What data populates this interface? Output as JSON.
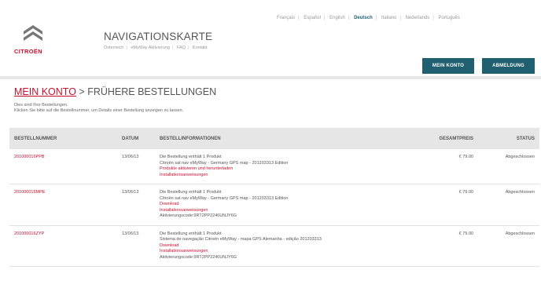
{
  "header": {
    "languages": [
      "Français",
      "Español",
      "English",
      "Deutsch",
      "Italiano",
      "Nederlands",
      "Português"
    ],
    "active_language": "Deutsch",
    "logo_text": "CITROËN",
    "site_title": "NAVIGATIONSKARTE",
    "subnav": [
      "Österreich",
      "eMyWay Aktivierung",
      "FAQ",
      "Kontakt"
    ],
    "buttons": {
      "account": "MEIN KONTO",
      "logout": "ABMELDUNG"
    }
  },
  "page": {
    "breadcrumb_link": "MEIN KONTO",
    "breadcrumb_separator": " > ",
    "breadcrumb_current": "FRÜHERE BESTELLUNGEN",
    "intro_line1": "Dies sind Ihre Bestellungen.",
    "intro_line2": "Klicken Sie bitte auf die Bestellnummer, um Details einer Bestellung anzeigen zu lassen."
  },
  "table": {
    "headers": {
      "order": "BESTELLNUMMER",
      "date": "DATUM",
      "info": "BESTELLINFORMATIONEN",
      "price": "GESAMTPREIS",
      "status": "STATUS"
    },
    "rows": [
      {
        "order": "201000016PPB",
        "date": "13/06/13",
        "info": [
          {
            "text": "Die Bestellung enthält 1 Produkt",
            "red": false
          },
          {
            "text": "Citroën sat nav eMyWay - Germany GPS map - 201203313 Edition",
            "red": false
          },
          {
            "text": "Produkte aktivieren und herunterladen",
            "red": true
          },
          {
            "text": "Installationsanweisungen",
            "red": true
          }
        ],
        "price": "€ 79.00",
        "status": "Abgeschlossen"
      },
      {
        "order": "201000016MPE",
        "date": "13/06/13",
        "info": [
          {
            "text": "Die Bestellung enthält 1 Produkt",
            "red": false
          },
          {
            "text": "Citroën sat nav eMyWay - Germany GPS map - 201203313 Edition",
            "red": false
          },
          {
            "text": "Download",
            "red": true
          },
          {
            "text": "Installationsanweisungen",
            "red": true
          },
          {
            "text": "Aktivierungscode:9RT2PP2240UNJY6G",
            "red": false
          }
        ],
        "price": "€ 79.00",
        "status": "Abgeschlossen"
      },
      {
        "order": "201000016ZYP",
        "date": "13/06/13",
        "info": [
          {
            "text": "Die Bestellung enthält 1 Produkt",
            "red": false
          },
          {
            "text": "Sistema de navegação Citroën eMyWay - mapa GPS Alemanha - edição 201203313",
            "red": false
          },
          {
            "text": "Download",
            "red": true
          },
          {
            "text": "Installationsanweisungen",
            "red": true
          },
          {
            "text": "Aktivierungscode:9RT2PP2240UNJY6G",
            "red": false
          }
        ],
        "price": "€ 79.00",
        "status": "Abgeschlossen"
      }
    ]
  },
  "colors": {
    "brand_red": "#c8102e",
    "teal": "#1f5f6f",
    "header_gray": "#e6e6e6"
  }
}
